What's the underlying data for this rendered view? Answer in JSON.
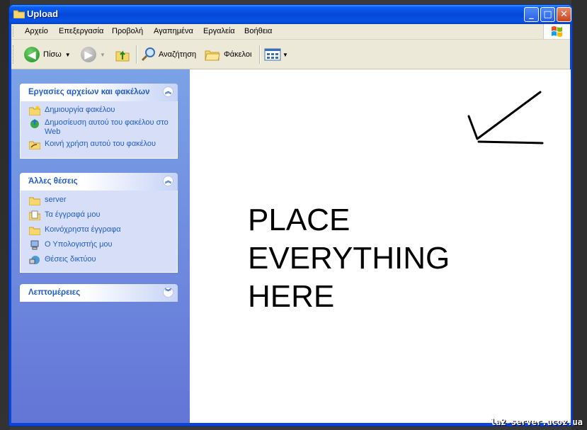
{
  "window": {
    "title": "Upload"
  },
  "menu": [
    "Αρχείο",
    "Επεξεργασία",
    "Προβολή",
    "Αγαπημένα",
    "Εργαλεία",
    "Βοήθεια"
  ],
  "toolbar": {
    "back_label": "Πίσω",
    "search_label": "Αναζήτηση",
    "folders_label": "Φάκελοι"
  },
  "tasks_panel": {
    "title": "Εργασίες αρχείων και φακέλων",
    "items": [
      {
        "label": "Δημιουργία φακέλου",
        "icon": "new-folder-icon"
      },
      {
        "label": "Δημοσίευση αυτού του φακέλου στο Web",
        "icon": "publish-web-icon"
      },
      {
        "label": "Κοινή χρήση αυτού του φακέλου",
        "icon": "share-folder-icon"
      }
    ]
  },
  "places_panel": {
    "title": "Άλλες θέσεις",
    "items": [
      {
        "label": "server",
        "icon": "folder-icon"
      },
      {
        "label": "Τα έγγραφά μου",
        "icon": "my-documents-icon"
      },
      {
        "label": "Κοινόχρηστα έγγραφα",
        "icon": "folder-icon"
      },
      {
        "label": "Ο Υπολογιστής μου",
        "icon": "my-computer-icon"
      },
      {
        "label": "Θέσεις δικτύου",
        "icon": "network-places-icon"
      }
    ]
  },
  "details_panel": {
    "title": "Λεπτομέρειες"
  },
  "content": {
    "annotation": "PLACE\nEVERYTHING\nHERE"
  },
  "watermark": "la2-server.ucoz.ua",
  "colors": {
    "title_bar": "#0a5ef0",
    "task_pane": "#7ba2e7",
    "panel_link": "#215dc6",
    "chrome": "#ece9d8"
  }
}
